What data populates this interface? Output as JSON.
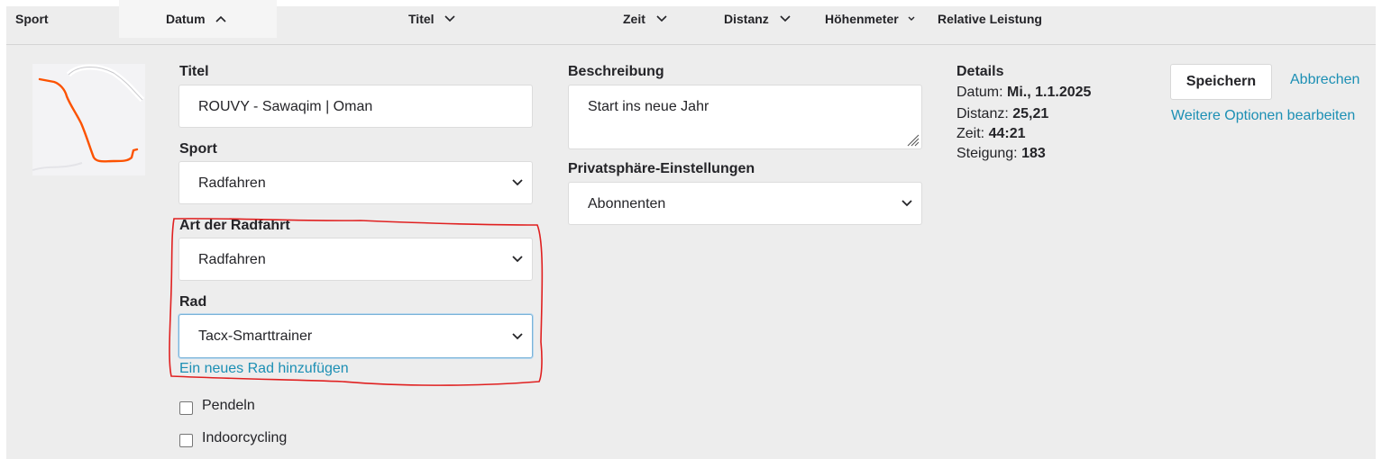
{
  "header": {
    "sport": "Sport",
    "datum": "Datum",
    "titel": "Titel",
    "zeit": "Zeit",
    "distanz": "Distanz",
    "hoehenmeter": "Höhenmeter",
    "relative_leistung": "Relative Leistung"
  },
  "form": {
    "titel_label": "Titel",
    "titel_value": "ROUVY - Sawaqim | Oman",
    "sport_label": "Sport",
    "sport_value": "Radfahren",
    "art_label": "Art der Radfahrt",
    "art_value": "Radfahren",
    "rad_label": "Rad",
    "rad_value": "Tacx-Smarttrainer",
    "add_bike_link": "Ein neues Rad hinzufügen",
    "pendeln_label": "Pendeln",
    "indoor_label": "Indoorcycling",
    "beschreibung_label": "Beschreibung",
    "beschreibung_value": "Start ins neue Jahr",
    "privacy_label": "Privatsphäre-Einstellungen",
    "privacy_value": "Abonnenten"
  },
  "details": {
    "title": "Details",
    "datum_label": "Datum:",
    "datum_value": "Mi., 1.1.2025",
    "distanz_label": "Distanz:",
    "distanz_value": "25,21",
    "zeit_label": "Zeit:",
    "zeit_value": "44:21",
    "steigung_label": "Steigung:",
    "steigung_value": "183"
  },
  "actions": {
    "save": "Speichern",
    "cancel": "Abbrechen",
    "more_options": "Weitere Optionen bearbeiten"
  },
  "colors": {
    "link": "#1c8fb4",
    "route": "#fc5200",
    "annotation": "#e02020"
  }
}
